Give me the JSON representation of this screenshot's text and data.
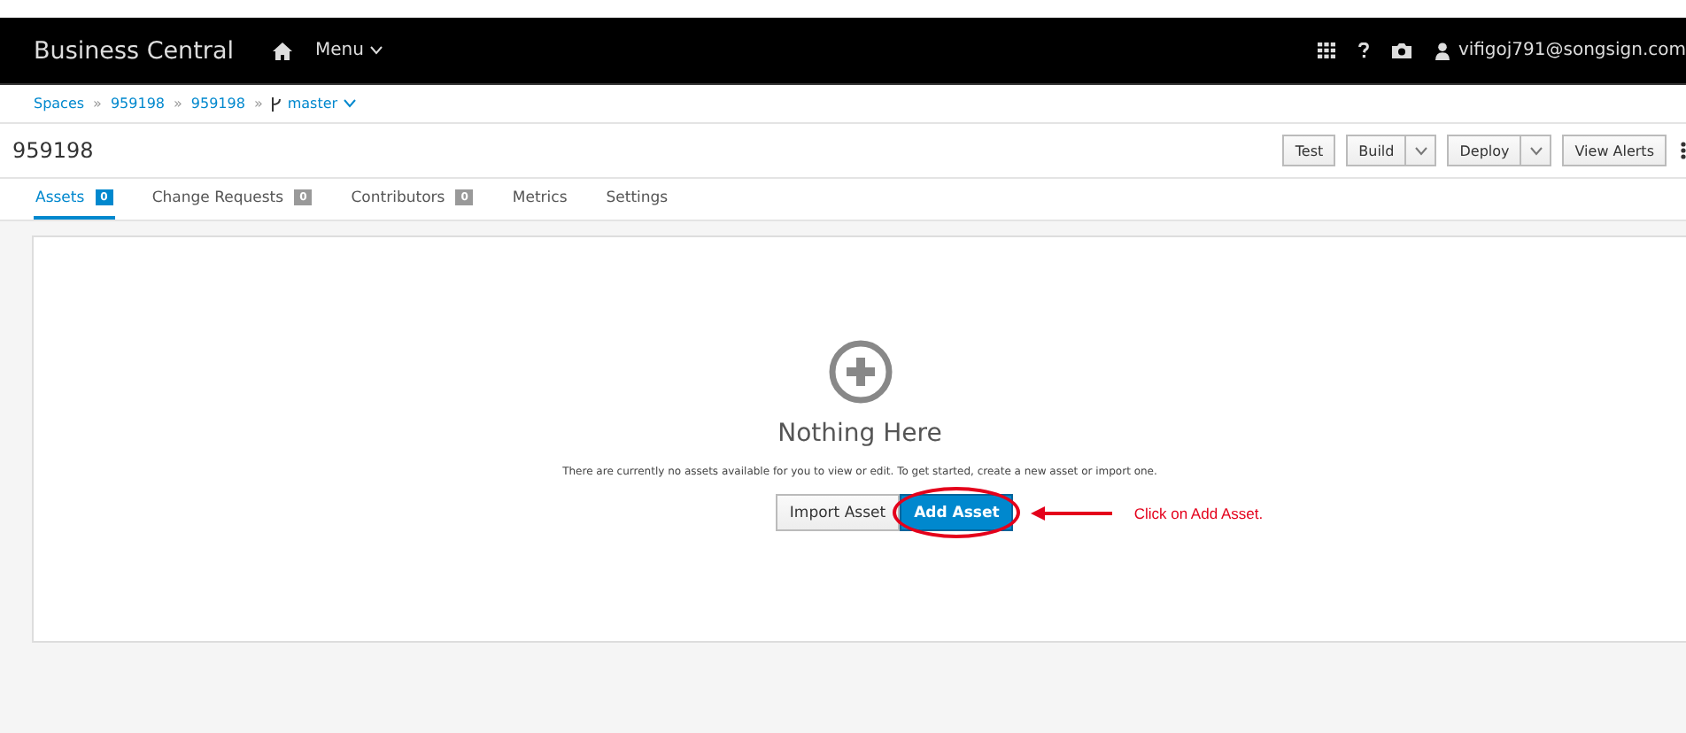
{
  "header": {
    "title": "Business Central",
    "menu": "Menu",
    "user": "vifigoj791@songsign.com"
  },
  "breadcrumb": {
    "separator": "»",
    "items": [
      {
        "label": "Spaces",
        "kind": "link"
      },
      {
        "label": "959198",
        "kind": "link"
      },
      {
        "label": "959198",
        "kind": "link"
      },
      {
        "label": "master",
        "kind": "branch"
      }
    ]
  },
  "project": {
    "title": "959198",
    "actions": [
      {
        "label": "Test",
        "kind": "button"
      },
      {
        "label": "Build",
        "kind": "split"
      },
      {
        "label": "Deploy",
        "kind": "split"
      },
      {
        "label": "View Alerts",
        "kind": "button"
      }
    ]
  },
  "tabs": [
    {
      "label": "Assets",
      "count": "0",
      "selected": true
    },
    {
      "label": "Change Requests",
      "count": "0",
      "selected": false
    },
    {
      "label": "Contributors",
      "count": "0",
      "selected": false
    },
    {
      "label": "Metrics",
      "selected": false
    },
    {
      "label": "Settings",
      "selected": false
    }
  ],
  "empty_state": {
    "heading": "Nothing Here",
    "message": "There are currently no assets available for you to view or edit. To get started, create a new asset or import one.",
    "buttons": [
      {
        "label": "Import Asset",
        "kind": "default",
        "highlighted": false
      },
      {
        "label": "Add Asset",
        "kind": "primary",
        "highlighted": true
      }
    ]
  },
  "annotation": {
    "text": "Click on Add Asset."
  }
}
